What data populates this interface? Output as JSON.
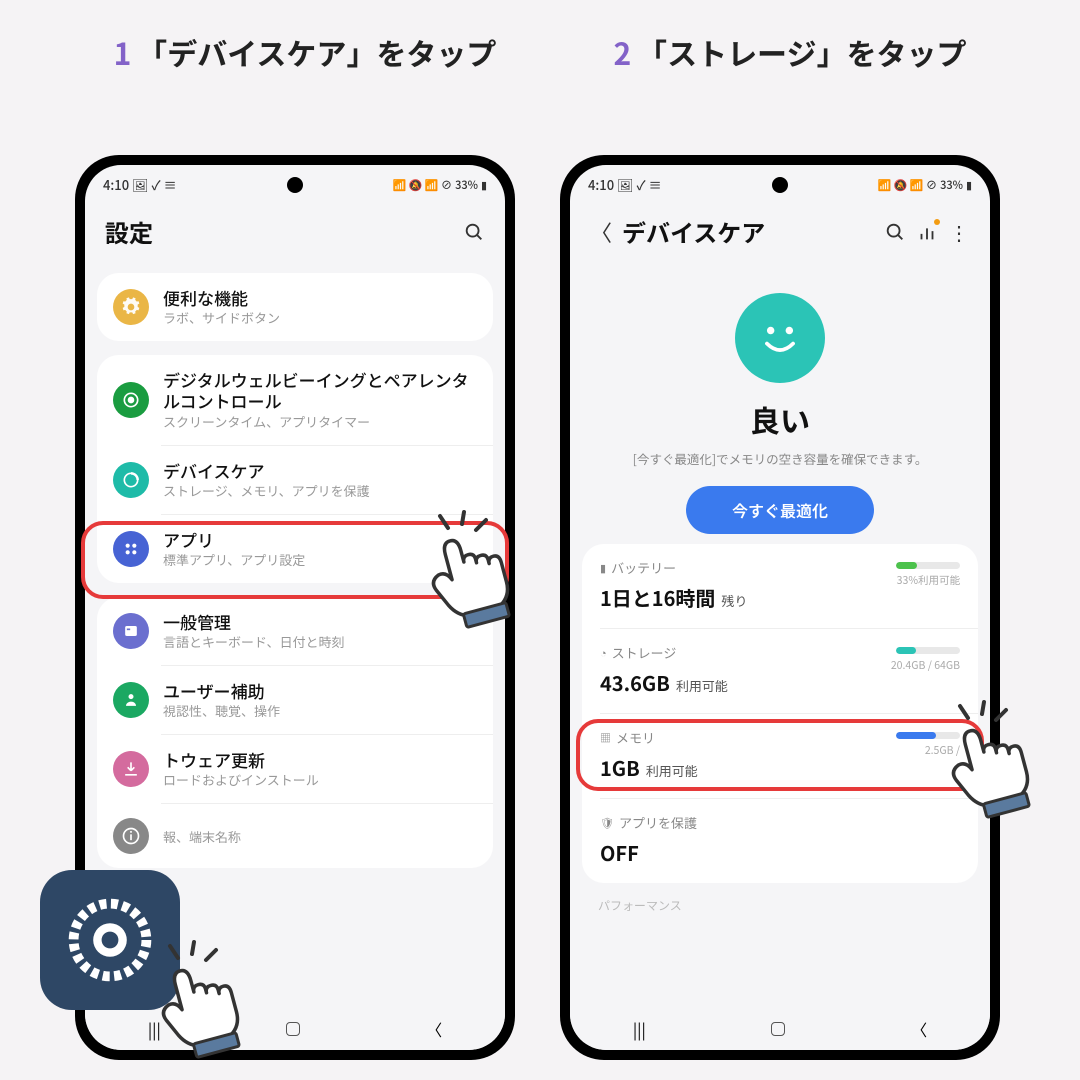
{
  "steps": {
    "s1": {
      "num": "1",
      "text": "「デバイスケア」をタップ"
    },
    "s2": {
      "num": "2",
      "text": "「ストレージ」をタップ"
    }
  },
  "status_bar": {
    "time": "4:10",
    "battery": "33%"
  },
  "screen1": {
    "title": "設定",
    "groups": [
      [
        {
          "icon": "gear",
          "color": "#eab646",
          "title": "便利な機能",
          "sub": "ラボ、サイドボタン"
        }
      ],
      [
        {
          "icon": "target",
          "color": "#1a9c40",
          "title": "デジタルウェルビーイングとペアレンタルコントロール",
          "sub": "スクリーンタイム、アプリタイマー"
        },
        {
          "icon": "care",
          "color": "#1ebba8",
          "title": "デバイスケア",
          "sub": "ストレージ、メモリ、アプリを保護",
          "highlight": true
        },
        {
          "icon": "grid",
          "color": "#4763d4",
          "title": "アプリ",
          "sub": "標準アプリ、アプリ設定"
        }
      ],
      [
        {
          "icon": "globe",
          "color": "#6b6fcf",
          "title": "一般管理",
          "sub": "言語とキーボード、日付と時刻"
        },
        {
          "icon": "person",
          "color": "#1ba862",
          "title": "ユーザー補助",
          "sub": "視認性、聴覚、操作"
        },
        {
          "icon": "down",
          "color": "#d46b9e",
          "title": "トウェア更新",
          "sub": "ロードおよびインストール"
        },
        {
          "icon": "info",
          "color": "#888",
          "title": "",
          "sub": "報、端末名称"
        }
      ]
    ]
  },
  "screen2": {
    "title": "デバイスケア",
    "status": "良い",
    "status_sub": "[今すぐ最適化]でメモリの空き容量を確保できます。",
    "optimize": "今すぐ最適化",
    "metrics": [
      {
        "key": "battery",
        "label": "バッテリー",
        "value": "1日と16時間",
        "unit": "残り",
        "bar_text": "33%利用可能",
        "bar_pct": 33,
        "bar_color": "#4cc24c"
      },
      {
        "key": "storage",
        "label": "ストレージ",
        "value": "43.6GB",
        "unit": "利用可能",
        "bar_text": "20.4GB / 64GB",
        "bar_pct": 32,
        "bar_color": "#2bc4b6",
        "highlight": true
      },
      {
        "key": "memory",
        "label": "メモリ",
        "value": "1GB",
        "unit": "利用可能",
        "bar_text": "2.5GB /",
        "bar_pct": 62,
        "bar_color": "#3a7aee"
      },
      {
        "key": "protect",
        "label": "アプリを保護",
        "value": "OFF",
        "unit": ""
      }
    ],
    "perf_label": "パフォーマンス"
  }
}
